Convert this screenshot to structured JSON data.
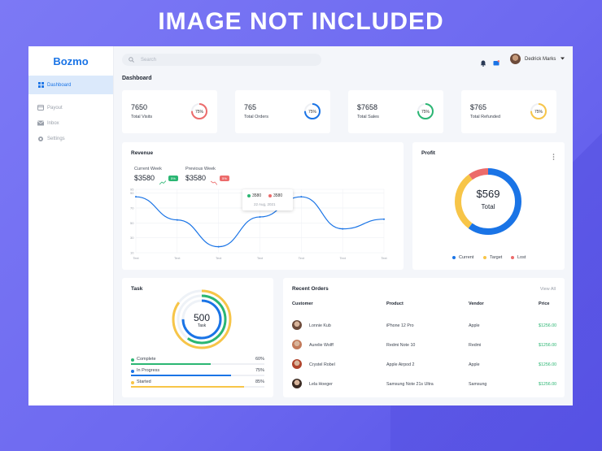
{
  "watermark": "IMAGE NOT INCLUDED",
  "sidebar": {
    "logo": "Bozmo",
    "items": [
      {
        "label": "Dashboard",
        "icon": "grid-icon",
        "active": true
      },
      {
        "label": "Payout",
        "icon": "card-icon",
        "active": false
      },
      {
        "label": "Inbox",
        "icon": "mail-icon",
        "active": false
      },
      {
        "label": "Settings",
        "icon": "gear-icon",
        "active": false
      }
    ]
  },
  "header": {
    "search_placeholder": "Search",
    "user_name": "Dedrick Marks",
    "page_title": "Dashboard"
  },
  "stats": [
    {
      "value": "7650",
      "label": "Total Visits",
      "percent": 75,
      "percent_label": "75%",
      "color": "#ec6b6b"
    },
    {
      "value": "765",
      "label": "Total Orders",
      "percent": 75,
      "percent_label": "75%",
      "color": "#1a74e6"
    },
    {
      "value": "$7658",
      "label": "Total Sales",
      "percent": 75,
      "percent_label": "75%",
      "color": "#2bb673"
    },
    {
      "value": "$765",
      "label": "Total Refunded",
      "percent": 75,
      "percent_label": "75%",
      "color": "#f7c548"
    }
  ],
  "revenue": {
    "title": "Revenue",
    "current_label": "Current Week",
    "current_value": "$3580",
    "current_badge": "5%",
    "previous_label": "Previous Week",
    "previous_value": "$3580",
    "previous_badge": "5%",
    "tooltip": {
      "value_a": "3580",
      "value_b": "3580",
      "date": "22 Aug, 2021"
    },
    "chart_data": {
      "type": "line",
      "x": [
        "Text",
        "Text",
        "Text",
        "Text",
        "Text",
        "Text",
        "Text"
      ],
      "y_ticks": [
        "10",
        "30",
        "50",
        "70",
        "90",
        "95"
      ],
      "ylim": [
        10,
        95
      ],
      "values": [
        85,
        54,
        18,
        58,
        85,
        42,
        55
      ]
    }
  },
  "profit": {
    "title": "Profit",
    "amount": "$569",
    "amount_label": "Total",
    "chart_data": {
      "type": "pie",
      "slices": [
        {
          "name": "Current",
          "value": 60,
          "color": "#1a74e6"
        },
        {
          "name": "Target",
          "value": 30,
          "color": "#f7c548"
        },
        {
          "name": "Lost",
          "value": 10,
          "color": "#ec6b6b"
        }
      ]
    }
  },
  "task": {
    "title": "Task",
    "total": "500",
    "total_label": "Task",
    "rows": [
      {
        "label": "Complete",
        "value": "60%",
        "fraction": 0.6,
        "color": "#2bb673"
      },
      {
        "label": "In Progress",
        "value": "75%",
        "fraction": 0.75,
        "color": "#1a74e6"
      },
      {
        "label": "Started",
        "value": "85%",
        "fraction": 0.85,
        "color": "#f7c548"
      }
    ]
  },
  "orders": {
    "title": "Recent Orders",
    "view_all": "View All",
    "columns": [
      "Customer",
      "Product",
      "Vendor",
      "Price"
    ],
    "rows": [
      {
        "customer": "Lonnie Kub",
        "product": "iPhone 12 Pro",
        "vendor": "Apple",
        "price": "$1256.00"
      },
      {
        "customer": "Aurelie Wolff",
        "product": "Redmi Note 10",
        "vendor": "Redmi",
        "price": "$1256.00"
      },
      {
        "customer": "Crystel Robel",
        "product": "Apple Airpod 2",
        "vendor": "Apple",
        "price": "$1256.00"
      },
      {
        "customer": "Lela Hoeger",
        "product": "Samsung Note 21s Ultra",
        "vendor": "Samsung",
        "price": "$1256.00"
      }
    ]
  }
}
